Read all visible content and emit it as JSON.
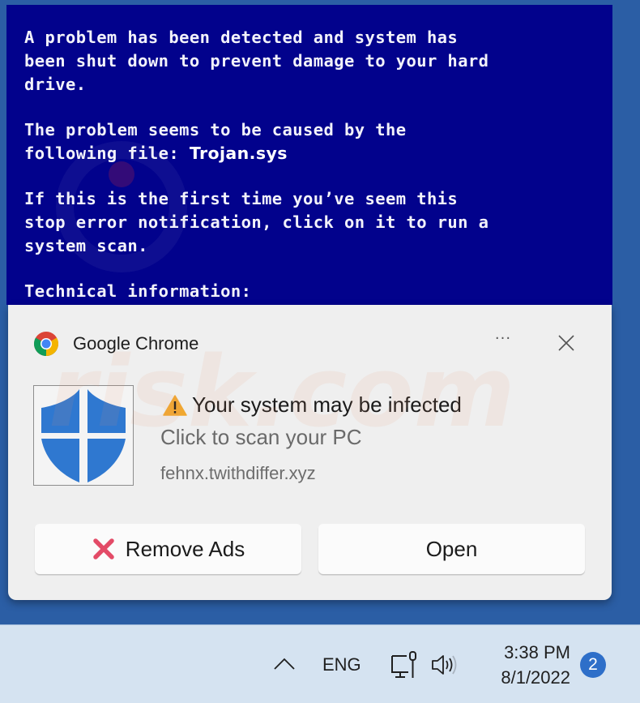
{
  "bsod": {
    "paragraph1": "A problem has been detected and system has\nbeen shut down to prevent damage to your hard\ndrive.",
    "paragraph2_line1": "The problem seems to be caused by the",
    "paragraph2_prefix": "following file: ",
    "file_name": "Trojan.sys",
    "paragraph3": "If this is the first time you’ve seem this\nstop error notification, click on it to run a\nsystem scan.",
    "paragraph4": "Technical information:"
  },
  "notification": {
    "app_name": "Google Chrome",
    "more_label": "···",
    "app_icon": "chrome-icon",
    "hero_icon": "shield-icon",
    "title_icon": "warning-icon",
    "title": "Your system may be infected",
    "body": "Click to scan your PC",
    "source": "fehnx.twithdiffer.xyz",
    "buttons": {
      "remove_ads": "Remove Ads",
      "open": "Open"
    },
    "colors": {
      "shield": "#2f78d0",
      "warning": "#f0a830",
      "remove_x": "#e34b67"
    }
  },
  "taskbar": {
    "language": "ENG",
    "time": "3:38 PM",
    "date": "8/1/2022",
    "notification_count": "2",
    "icons": [
      "chevron-up-icon",
      "network-icon",
      "volume-icon"
    ]
  }
}
